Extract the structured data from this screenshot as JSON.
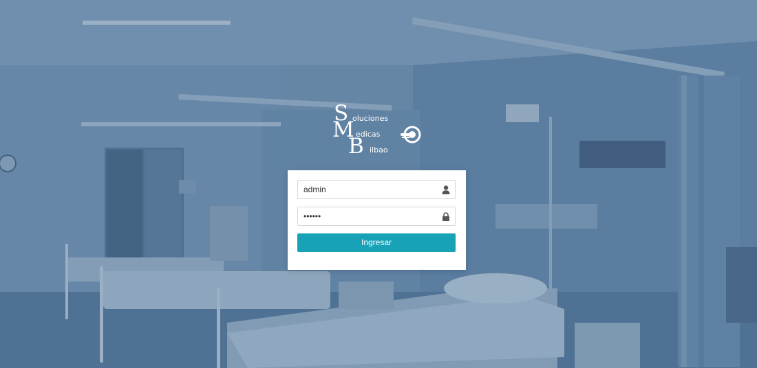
{
  "logo": {
    "initial_s": "S",
    "initial_m": "M",
    "initial_b": "B",
    "word_s": "oluciones",
    "word_m": "edicas",
    "word_b": "ilbao",
    "emblem_icon": "mri-scanner-icon"
  },
  "login": {
    "username_value": "admin",
    "password_value": "••••••",
    "user_icon": "user-icon",
    "lock_icon": "lock-icon",
    "submit_label": "Ingresar"
  },
  "colors": {
    "button": "#17a2b8",
    "overlay": "#3f6a92"
  }
}
